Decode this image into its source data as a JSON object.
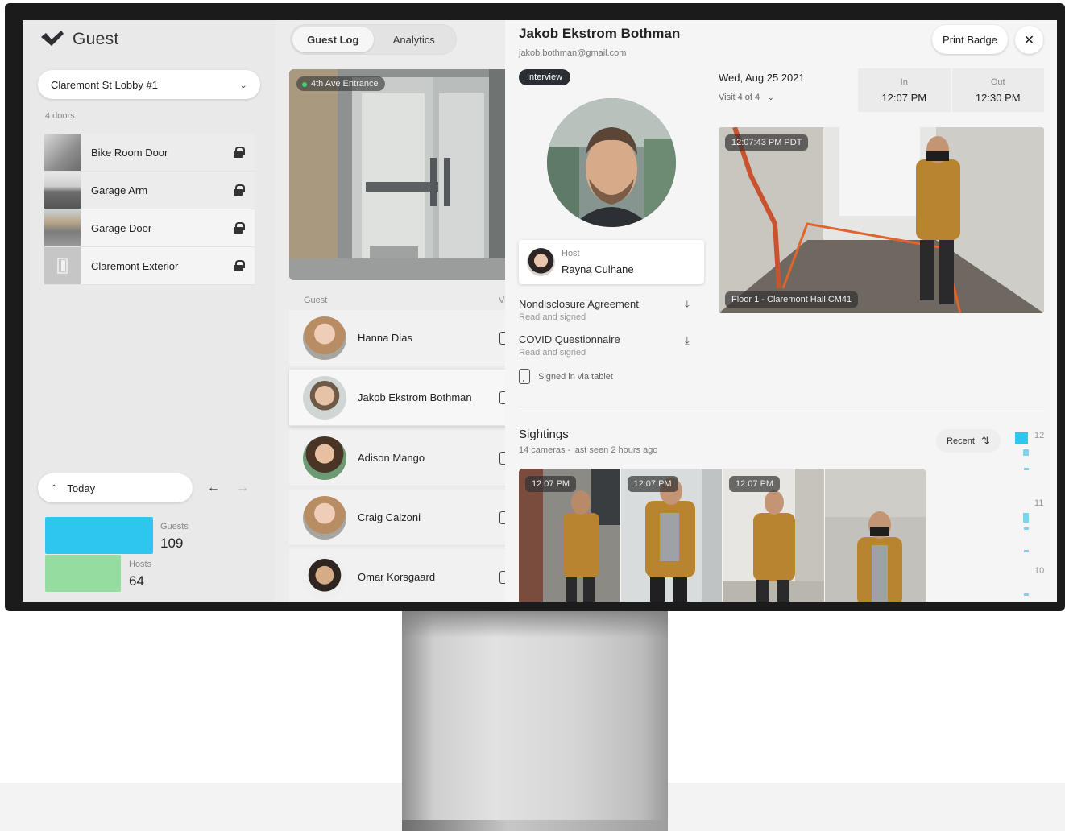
{
  "app": {
    "name": "Guest"
  },
  "sidebar": {
    "site": "Claremont St Lobby #1",
    "doors_count": "4 doors",
    "doors": [
      {
        "label": "Bike Room Door"
      },
      {
        "label": "Garage Arm"
      },
      {
        "label": "Garage Door"
      },
      {
        "label": "Claremont Exterior"
      }
    ],
    "period": "Today",
    "stats": [
      {
        "label": "Guests",
        "value": "109",
        "color": "#2ec5ef"
      },
      {
        "label": "Hosts",
        "value": "64",
        "color": "#95dca0"
      }
    ]
  },
  "tabs": [
    {
      "label": "Guest Log"
    },
    {
      "label": "Analytics"
    }
  ],
  "camera": {
    "name": "4th Ave Entrance",
    "status_color": "#3ed07a"
  },
  "guest_list": {
    "column_guest": "Guest",
    "column_visit": "Vi",
    "guests": [
      {
        "name": "Hanna Dias"
      },
      {
        "name": "Jakob Ekstrom Bothman"
      },
      {
        "name": "Adison Mango"
      },
      {
        "name": "Craig Calzoni"
      },
      {
        "name": "Omar Korsgaard"
      }
    ]
  },
  "detail": {
    "name": "Jakob Ekstrom Bothman",
    "email": "jakob.bothman@gmail.com",
    "badge": "Interview",
    "print_label": "Print Badge",
    "host_label": "Host",
    "host_name": "Rayna Culhane",
    "documents": [
      {
        "title": "Nondisclosure Agreement",
        "status": "Read and signed"
      },
      {
        "title": "COVID Questionnaire",
        "status": "Read and signed"
      }
    ],
    "signed_in": "Signed in via tablet",
    "visit_date": "Wed, Aug 25 2021",
    "visit_number": "Visit 4 of 4",
    "in_label": "In",
    "in_time": "12:07 PM",
    "out_label": "Out",
    "out_time": "12:30 PM",
    "camera_timestamp": "12:07:43 PM PDT",
    "camera_location": "Floor 1 - Claremont Hall CM41"
  },
  "sightings": {
    "title": "Sightings",
    "subtitle": "14 cameras - last seen 2 hours ago",
    "sort_label": "Recent",
    "thumbs": [
      {
        "time": "12:07 PM"
      },
      {
        "time": "12:07 PM"
      },
      {
        "time": "12:07 PM"
      }
    ],
    "timeline_labels": [
      "12",
      "11",
      "10"
    ],
    "accent": "#2ec5ef"
  }
}
